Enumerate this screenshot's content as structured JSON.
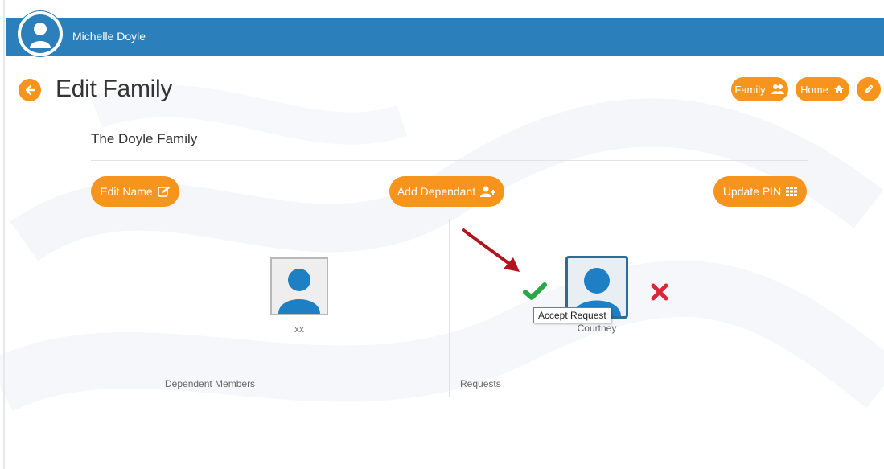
{
  "header": {
    "user_name": "Michelle Doyle"
  },
  "page": {
    "title": "Edit Family"
  },
  "nav": {
    "family_label": "Family",
    "home_label": "Home"
  },
  "family": {
    "name": "The Doyle Family"
  },
  "actions": {
    "edit_name_label": "Edit Name",
    "add_dependant_label": "Add Dependant",
    "update_pin_label": "Update PIN"
  },
  "dependents": {
    "section_label": "Dependent Members",
    "members": [
      {
        "name": "xx"
      }
    ]
  },
  "requests": {
    "section_label": "Requests",
    "items": [
      {
        "name": "Courtney"
      }
    ],
    "tooltip": "Accept Request"
  },
  "colors": {
    "header_blue": "#2b7fba",
    "accent_orange": "#f7941d",
    "accept_green": "#28a745",
    "reject_red": "#d9263a",
    "annotation_arrow": "#b0141c"
  },
  "icons": [
    "user-avatar-icon",
    "back-arrow-icon",
    "users-icon",
    "home-icon",
    "paperclip-icon",
    "edit-icon",
    "user-plus-icon",
    "grid-icon",
    "checkmark-icon",
    "x-icon",
    "annotation-arrow"
  ]
}
